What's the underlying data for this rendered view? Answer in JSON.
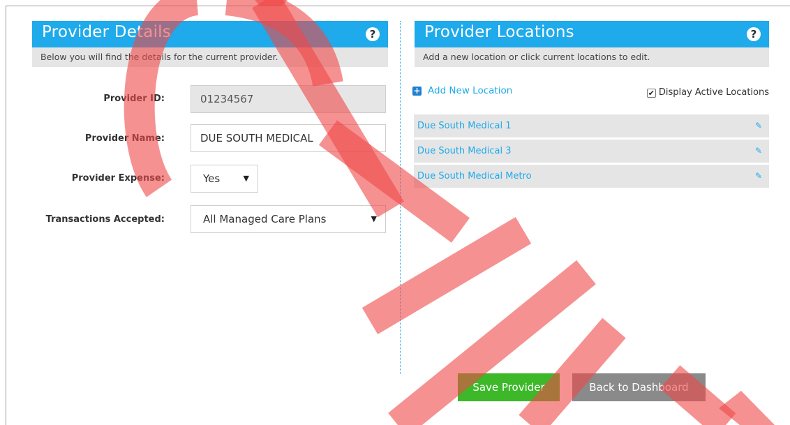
{
  "provider_details": {
    "title": "Provider Details",
    "help_icon": "question-circle-icon",
    "subtitle": "Below you will find the details for the current provider.",
    "fields": {
      "provider_id_label": "Provider ID:",
      "provider_id_value": "01234567",
      "provider_name_label": "Provider Name:",
      "provider_name_value": "DUE SOUTH MEDICAL",
      "provider_expense_label": "Provider Expense:",
      "provider_expense_value": "Yes",
      "transactions_label": "Transactions Accepted:",
      "transactions_value": "All Managed Care Plans"
    }
  },
  "provider_locations": {
    "title": "Provider Locations",
    "help_icon": "question-circle-icon",
    "subtitle": "Add a new location or click current locations to edit.",
    "add_label": "Add New Location",
    "display_active_label": "Display Active Locations",
    "display_active_checked": true,
    "locations": [
      {
        "name": "Due South Medical 1"
      },
      {
        "name": "Due South Medical 3"
      },
      {
        "name": "Due South Medical Metro"
      }
    ]
  },
  "buttons": {
    "save": "Save Provider",
    "back": "Back to Dashboard"
  },
  "colors": {
    "header_blue": "#1eaaeb",
    "subheader_gray": "#e5e5e5",
    "save_green": "#3cb829",
    "back_gray": "#8a8a8a",
    "watermark_red": "#f04848"
  },
  "watermark": "SAMPLE"
}
